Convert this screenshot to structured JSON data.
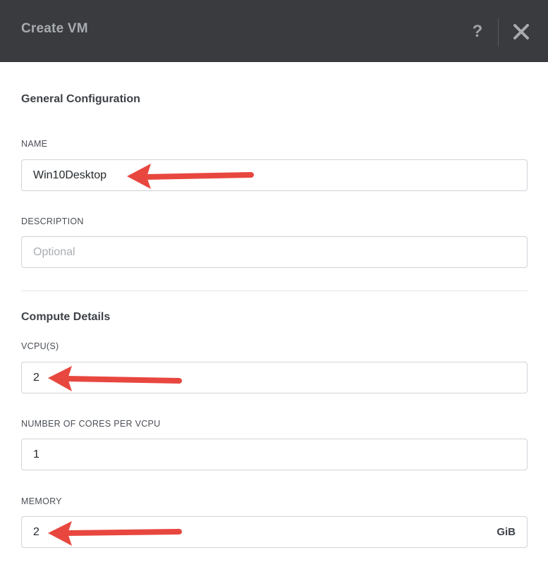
{
  "dialog": {
    "title": "Create VM",
    "help_label": "?",
    "close_icon": "close-icon"
  },
  "general": {
    "section_title": "General Configuration",
    "name": {
      "label": "NAME",
      "value": "Win10Desktop"
    },
    "description": {
      "label": "DESCRIPTION",
      "placeholder": "Optional",
      "value": ""
    }
  },
  "compute": {
    "section_title": "Compute Details",
    "vcpus": {
      "label": "VCPU(S)",
      "value": "2"
    },
    "cores_per_vcpu": {
      "label": "NUMBER OF CORES PER VCPU",
      "value": "1"
    },
    "memory": {
      "label": "MEMORY",
      "value": "2",
      "unit": "GiB"
    }
  },
  "colors": {
    "titlebar_bg": "#3a3b3e",
    "annotation_arrow": "#e8473f",
    "field_border": "#cfd3d8"
  }
}
